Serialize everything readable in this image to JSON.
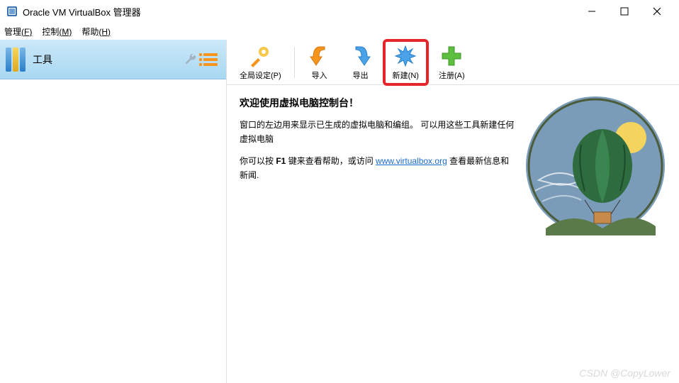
{
  "titlebar": {
    "title": "Oracle VM VirtualBox 管理器"
  },
  "menubar": {
    "file": "管理",
    "file_key": "(F)",
    "control": "控制",
    "control_key": "(M)",
    "help": "帮助",
    "help_key": "(H)"
  },
  "sidebar": {
    "tools_label": "工具"
  },
  "toolbar": {
    "settings": "全局设定(P)",
    "import": "导入",
    "export": "导出",
    "new": "新建(N)",
    "register": "注册(A)"
  },
  "welcome": {
    "heading": "欢迎使用虚拟电脑控制台！",
    "p1": "窗口的左边用来显示已生成的虚拟电脑和编组。 可以用这些工具新建任何虚拟电脑",
    "p2_pre": "你可以按 ",
    "p2_key": "F1",
    "p2_mid": " 键来查看帮助，或访问 ",
    "link": "www.virtualbox.org",
    "p2_post": " 查看最新信息和新闻."
  },
  "watermark": "CSDN @CopyLower"
}
